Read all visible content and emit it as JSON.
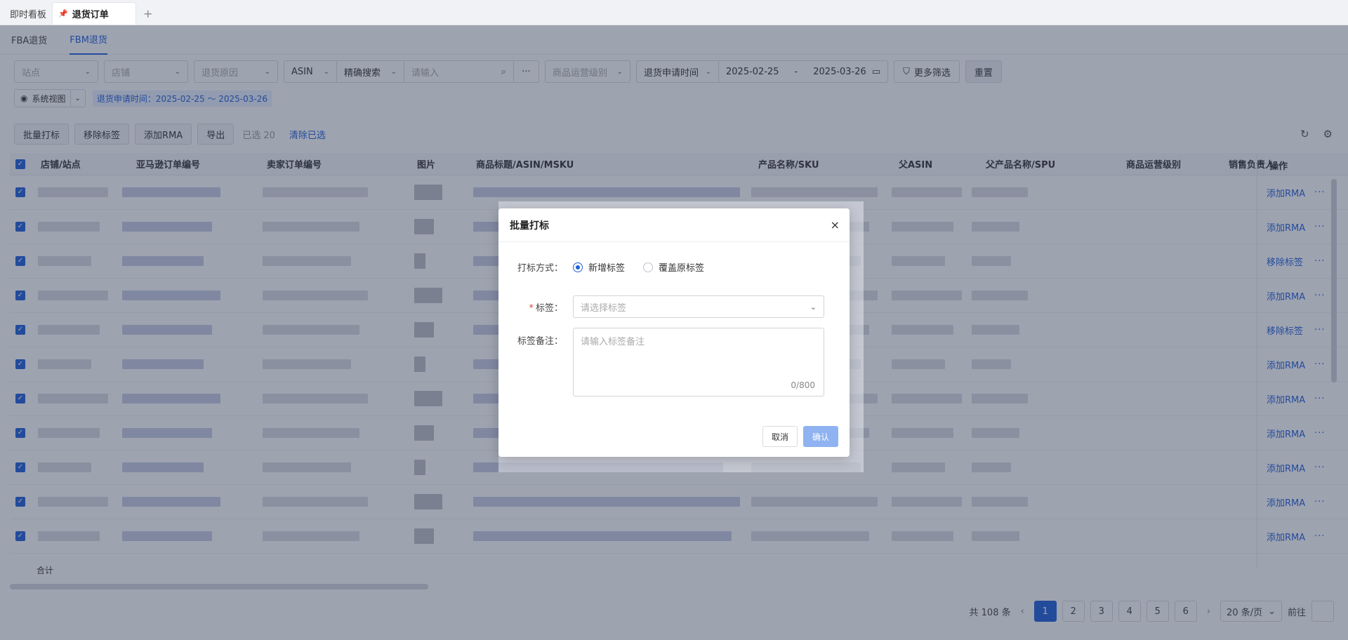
{
  "tabs": {
    "dashboard": "即时看板",
    "return_orders": "退货订单",
    "add": "+"
  },
  "subtabs": {
    "fba": "FBA退货",
    "fbm": "FBM退货"
  },
  "filters": {
    "site": "站点",
    "store": "店铺",
    "reason": "退货原因",
    "asin": "ASIN",
    "match": "精确搜索",
    "search_placeholder": "请输入",
    "level": "商品运营级别",
    "date_type": "退货申请时间",
    "date_start": "2025-02-25",
    "date_sep": "-",
    "date_end": "2025-03-26",
    "more": "更多筛选",
    "reset": "重置",
    "view": "系统视图",
    "active_filter": "退货申请时间：2025-02-25 ～ 2025-03-26"
  },
  "actions": {
    "batch_label": "批量打标",
    "remove_label": "移除标签",
    "add_rma": "添加RMA",
    "export": "导出",
    "selected": "已选 20",
    "clear": "清除已选"
  },
  "table": {
    "headers": [
      "店铺/站点",
      "亚马逊订单编号",
      "卖家订单编号",
      "图片",
      "商品标题/ASIN/MSKU",
      "产品名称/SKU",
      "父ASIN",
      "父产品名称/SPU",
      "商品运营级别",
      "销售负责人",
      "操作"
    ],
    "ops": [
      "添加RMA",
      "添加RMA",
      "移除标签",
      "添加RMA",
      "移除标签",
      "添加RMA",
      "添加RMA",
      "添加RMA",
      "添加RMA",
      "添加RMA",
      "添加RMA"
    ],
    "more": "···",
    "total_label": "合计"
  },
  "pagination": {
    "total": "共 108 条",
    "prev": "‹",
    "next": "›",
    "pages": [
      "1",
      "2",
      "3",
      "4",
      "5",
      "6"
    ],
    "size": "20 条/页",
    "jump": "前往"
  },
  "modal": {
    "title": "批量打标",
    "close": "×",
    "mode_label": "打标方式：",
    "mode_new": "新增标签",
    "mode_cover": "覆盖原标签",
    "tag_label": "标签：",
    "tag_placeholder": "请选择标签",
    "remark_label": "标签备注：",
    "remark_placeholder": "请输入标签备注",
    "remark_count": "0/800",
    "cancel": "取消",
    "confirm": "确认"
  }
}
